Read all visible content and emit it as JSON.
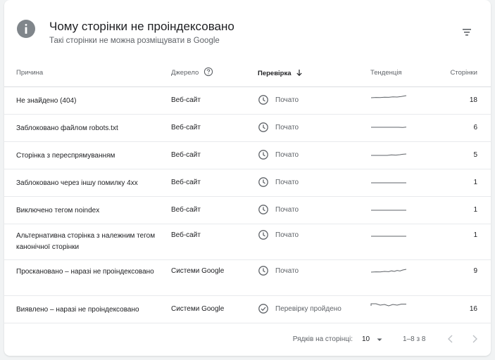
{
  "header": {
    "title": "Чому сторінки не проіндексовано",
    "subtitle": "Такі сторінки не можна розміщувати в Google"
  },
  "columns": {
    "reason": "Причина",
    "source": "Джерело",
    "validation": "Перевірка",
    "trend": "Тенденція",
    "pages": "Сторінки"
  },
  "rows": [
    {
      "reason": "Не знайдено (404)",
      "source": "Веб-сайт",
      "status": "Почато",
      "status_icon": "clock-icon",
      "pages": "18"
    },
    {
      "reason": "Заблоковано файлом robots.txt",
      "source": "Веб-сайт",
      "status": "Почато",
      "status_icon": "clock-icon",
      "pages": "6"
    },
    {
      "reason": "Сторінка з переспрямуванням",
      "source": "Веб-сайт",
      "status": "Почато",
      "status_icon": "clock-icon",
      "pages": "5"
    },
    {
      "reason": "Заблоковано через іншу помилку 4xx",
      "source": "Веб-сайт",
      "status": "Почато",
      "status_icon": "clock-icon",
      "pages": "1"
    },
    {
      "reason": "Виключено тегом noindex",
      "source": "Веб-сайт",
      "status": "Почато",
      "status_icon": "clock-icon",
      "pages": "1"
    },
    {
      "reason": "Альтернативна сторінка з належним тегом канонічної сторінки",
      "source": "Веб-сайт",
      "status": "Почато",
      "status_icon": "clock-icon",
      "pages": "1"
    },
    {
      "reason": "Проскановано – наразі не проіндексовано",
      "source": "Системи Google",
      "status": "Почато",
      "status_icon": "clock-icon",
      "pages": "9"
    },
    {
      "reason": "Виявлено – наразі не проіндексовано",
      "source": "Системи Google",
      "status": "Перевірку пройдено",
      "status_icon": "check-circle-icon",
      "pages": "16"
    }
  ],
  "footer": {
    "rows_per_page_label": "Рядків на сторінці:",
    "rows_per_page_value": "10",
    "range": "1–8 з 8"
  },
  "colors": {
    "icon_gray": "#80868b",
    "text_secondary": "#5f6368",
    "divider": "#dadce0"
  }
}
